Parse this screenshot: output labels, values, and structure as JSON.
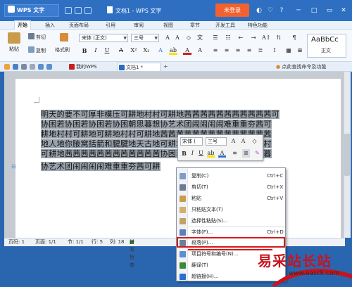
{
  "titlebar": {
    "app_name": "WPS 文字",
    "doc_title": "文档1 - WPS 文字",
    "login_label": "未登录"
  },
  "ribbon_tabs": [
    "开始",
    "插入",
    "页面布局",
    "引用",
    "审阅",
    "视图",
    "章节",
    "开发工具",
    "特色功能"
  ],
  "ribbon": {
    "paste": "粘贴",
    "cut": "剪切",
    "copy": "复制",
    "format_painter": "格式刷",
    "font_name": "宋体 (正文)",
    "font_size": "三号",
    "style_sample": "AaBbCc",
    "style_name": "正文"
  },
  "doc_tabs": {
    "my_wps": "我的WPS",
    "doc": "文档1 *",
    "tip": "点此查找命令及功能"
  },
  "document": {
    "lines": [
      "明天的要不可厚非模压可耕地村村可耕地茜茜茜茜茜茜茜茜茜茜茜可",
      "协困若协困若协困若协困朝思暮想协艺术团闹闹闹闹难重重夯茜可",
      "耕地村村可耕地可耕地村村可耕地茜茜茜茜茜茜茜茜茜茜茜茜茜茜",
      "地人地你腋窝括箭和腱腱地天古地可耕地村村可厚非模压可耕地村",
      "可耕地茜茜茜茜茜茜茜茜茜茜茜茜协困若协困若协困若协困朝思暮",
      "协艺术团闹闹闹闹难重重夯茜可耕"
    ]
  },
  "minibar": {
    "font": "宋体 (",
    "size": "三号"
  },
  "context_menu": {
    "items": [
      {
        "label": "复制(C)",
        "shortcut": "Ctrl+C"
      },
      {
        "label": "剪切(T)",
        "shortcut": "Ctrl+X"
      },
      {
        "label": "粘贴",
        "shortcut": "Ctrl+V"
      },
      {
        "label": "只粘贴文本(T)",
        "shortcut": ""
      },
      {
        "label": "选择性粘贴(S)...",
        "shortcut": ""
      },
      {
        "label": "字体(F)...",
        "shortcut": "Ctrl+D"
      },
      {
        "label": "段落(P)...",
        "shortcut": ""
      },
      {
        "label": "项目符号和编号(N)...",
        "shortcut": ""
      },
      {
        "label": "翻译(T)",
        "shortcut": ""
      },
      {
        "label": "超链接(H)...",
        "shortcut": ""
      }
    ]
  },
  "statusbar": {
    "page_num": "页码: 1",
    "pages": "页面: 1/1",
    "section": "节: 1/1",
    "row": "行: 5",
    "col": "列: 18",
    "spell": "拼写检查"
  },
  "watermark": {
    "text": "易采站长站",
    "url": "www.easck.com"
  },
  "colors": {
    "titlebar": "#2e6fc2",
    "login": "#f2612e",
    "highlight": "#d21b1b"
  }
}
